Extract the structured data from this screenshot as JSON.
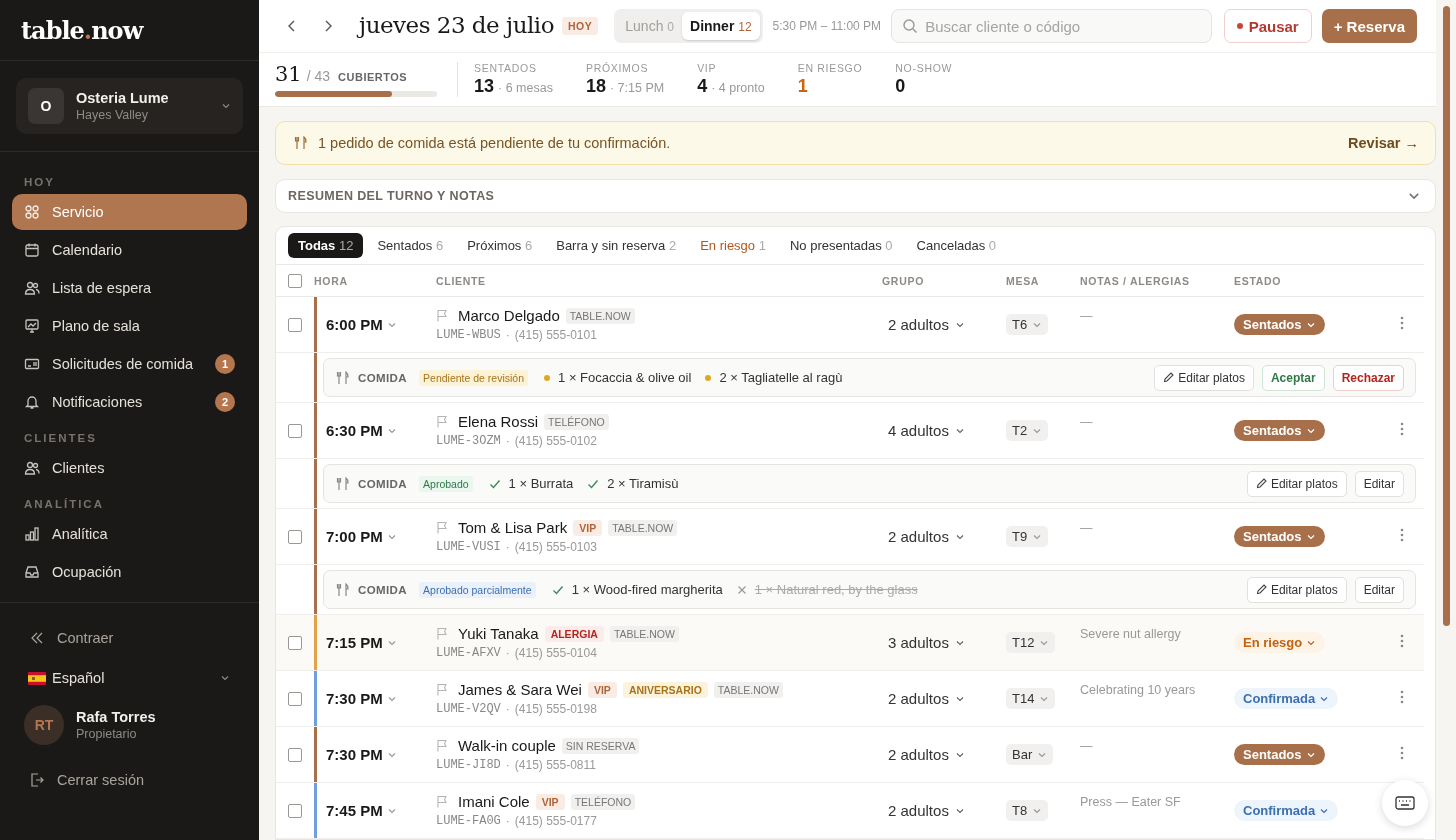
{
  "logo": {
    "before": "table",
    "dot": ".",
    "after": "now"
  },
  "venue": {
    "initial": "O",
    "name": "Osteria Lume",
    "area": "Hayes Valley"
  },
  "nav_sections": [
    {
      "title": "HOY",
      "items": [
        {
          "label": "Servicio",
          "kind": "grid",
          "selected": true
        },
        {
          "label": "Calendario",
          "kind": "calendar",
          "selected": false
        },
        {
          "label": "Lista de espera",
          "kind": "users",
          "selected": false
        },
        {
          "label": "Plano de sala",
          "kind": "board",
          "selected": false
        },
        {
          "label": "Solicitudes de comida",
          "kind": "ticket",
          "selected": false,
          "badge": "1"
        },
        {
          "label": "Notificaciones",
          "kind": "bell",
          "selected": false,
          "badge": "2"
        }
      ]
    },
    {
      "title": "CLIENTES",
      "items": [
        {
          "label": "Clientes",
          "kind": "users",
          "selected": false
        }
      ]
    },
    {
      "title": "ANALÍTICA",
      "items": [
        {
          "label": "Analítica",
          "kind": "chart",
          "selected": false
        },
        {
          "label": "Ocupación",
          "kind": "inbox",
          "selected": false
        }
      ]
    }
  ],
  "sidebar_footer": {
    "collapse": "Contraer",
    "language": "Español",
    "user": {
      "initials": "RT",
      "name": "Rafa Torres",
      "role": "Propietario"
    },
    "logout": "Cerrar sesión"
  },
  "header": {
    "date": "jueves 23 de julio",
    "today": "HOY",
    "shifts": [
      {
        "label": "Lunch",
        "count": "0",
        "selected": false
      },
      {
        "label": "Dinner",
        "count": "12",
        "selected": true
      }
    ],
    "hours": "5:30 PM – 11:00 PM",
    "search": {
      "placeholder": "Buscar cliente o código"
    },
    "pause": "Pausar",
    "new": "+ Reserva"
  },
  "stats": {
    "covers": {
      "value": "31",
      "total": "/ 43",
      "label": "CUBIERTOS",
      "level": 0.72
    },
    "metrics": [
      {
        "label": "SENTADOS",
        "value": "13",
        "detail": "· 6 mesas",
        "kind": "normal"
      },
      {
        "label": "PRÓXIMOS",
        "value": "18",
        "detail": "· 7:15 PM",
        "kind": "normal"
      },
      {
        "label": "VIP",
        "value": "4",
        "detail": "· 4 pronto",
        "kind": "normal"
      },
      {
        "label": "EN RIESGO",
        "value": "1",
        "kind": "warn"
      },
      {
        "label": "NO-SHOW",
        "value": "0",
        "kind": "normal"
      }
    ]
  },
  "alert": {
    "text": "1 pedido de comida está pendiente de tu confirmación.",
    "action": "Revisar →"
  },
  "summary": {
    "title": "RESUMEN DEL TURNO Y NOTAS"
  },
  "filters": [
    {
      "label": "Todas",
      "count": "12",
      "selected": true,
      "kind": "normal"
    },
    {
      "label": "Sentados",
      "count": "6",
      "selected": false,
      "kind": "normal"
    },
    {
      "label": "Próximos",
      "count": "6",
      "selected": false,
      "kind": "normal"
    },
    {
      "label": "Barra y sin reserva",
      "count": "2",
      "selected": false,
      "kind": "normal"
    },
    {
      "label": "En riesgo",
      "count": "1",
      "selected": false,
      "kind": "warn"
    },
    {
      "label": "No presentadas",
      "count": "0",
      "selected": false,
      "kind": "normal"
    },
    {
      "label": "Canceladas",
      "count": "0",
      "selected": false,
      "kind": "normal"
    }
  ],
  "table": {
    "select_all": {
      "checked": false
    },
    "columns": [
      "HORA",
      "CLIENTE",
      "GRUPO",
      "MESA",
      "NOTAS / ALERGIAS",
      "ESTADO"
    ],
    "rows": [
      {
        "checked": false,
        "time": "6:00 PM",
        "name": "Marco Delgado",
        "tags": [
          {
            "text": "TABLE.NOW",
            "kind": "source"
          }
        ],
        "code": "LUME-WBUS",
        "separator": "·",
        "phone": "(415) 555-0101",
        "party": "2 adultos",
        "table": "T6",
        "notes": "—",
        "status": {
          "label": "Sentados",
          "kind": "seated"
        },
        "food": {
          "label": "COMIDA",
          "status": {
            "text": "Pendiente de revisión",
            "kind": "pending"
          },
          "items": [
            {
              "text": "1 × Focaccia & olive oil",
              "kind": "pending"
            },
            {
              "text": "2 × Tagliatelle al ragù",
              "kind": "pending"
            }
          ],
          "actions": [
            {
              "label": "Editar platos",
              "kind": "edit"
            },
            {
              "label": "Aceptar",
              "kind": "accept"
            },
            {
              "label": "Rechazar",
              "kind": "reject"
            }
          ]
        }
      },
      {
        "checked": false,
        "time": "6:30 PM",
        "name": "Elena Rossi",
        "tags": [
          {
            "text": "TELÉFONO",
            "kind": "source"
          }
        ],
        "code": "LUME-3OZM",
        "separator": "·",
        "phone": "(415) 555-0102",
        "party": "4 adultos",
        "table": "T2",
        "notes": "—",
        "status": {
          "label": "Sentados",
          "kind": "seated"
        },
        "food": {
          "label": "COMIDA",
          "status": {
            "text": "Aprobado",
            "kind": "approved"
          },
          "items": [
            {
              "text": "1 × Burrata",
              "kind": "approved"
            },
            {
              "text": "2 × Tiramisù",
              "kind": "approved"
            }
          ],
          "actions": [
            {
              "label": "Editar platos",
              "kind": "edit"
            },
            {
              "label": "Editar",
              "kind": "plain"
            }
          ]
        }
      },
      {
        "checked": false,
        "time": "7:00 PM",
        "name": "Tom & Lisa Park",
        "tags": [
          {
            "text": "VIP",
            "kind": "vip"
          },
          {
            "text": "TABLE.NOW",
            "kind": "source"
          }
        ],
        "code": "LUME-VUSI",
        "separator": "·",
        "phone": "(415) 555-0103",
        "party": "2 adultos",
        "table": "T9",
        "notes": "—",
        "status": {
          "label": "Sentados",
          "kind": "seated"
        },
        "food": {
          "label": "COMIDA",
          "status": {
            "text": "Aprobado parcialmente",
            "kind": "partial"
          },
          "items": [
            {
              "text": "1 × Wood-fired margherita",
              "kind": "approved"
            },
            {
              "text": "1 × Natural red, by the glass",
              "kind": "rejected"
            }
          ],
          "actions": [
            {
              "label": "Editar platos",
              "kind": "edit"
            },
            {
              "label": "Editar",
              "kind": "plain"
            }
          ]
        }
      },
      {
        "checked": false,
        "time": "7:15 PM",
        "name": "Yuki Tanaka",
        "tags": [
          {
            "text": "ALERGIA",
            "kind": "allergy"
          },
          {
            "text": "TABLE.NOW",
            "kind": "source"
          }
        ],
        "code": "LUME-AFXV",
        "separator": "·",
        "phone": "(415) 555-0104",
        "party": "3 adultos",
        "table": "T12",
        "notes": "Severe nut allergy",
        "status": {
          "label": "En riesgo",
          "kind": "risk"
        }
      },
      {
        "checked": false,
        "time": "7:30 PM",
        "name": "James & Sara Wei",
        "tags": [
          {
            "text": "VIP",
            "kind": "vip"
          },
          {
            "text": "ANIVERSARIO",
            "kind": "anniversary"
          },
          {
            "text": "TABLE.NOW",
            "kind": "source"
          }
        ],
        "code": "LUME-V2QV",
        "separator": "·",
        "phone": "(415) 555-0198",
        "party": "2 adultos",
        "table": "T14",
        "notes": "Celebrating 10 years",
        "status": {
          "label": "Confirmada",
          "kind": "confirmed"
        }
      },
      {
        "checked": false,
        "time": "7:30 PM",
        "name": "Walk-in couple",
        "tags": [
          {
            "text": "SIN RESERVA",
            "kind": "source"
          }
        ],
        "code": "LUME-JI8D",
        "separator": "·",
        "phone": "(415) 555-0811",
        "party": "2 adultos",
        "table": "Bar",
        "notes": "—",
        "status": {
          "label": "Sentados",
          "kind": "seated"
        }
      },
      {
        "checked": false,
        "time": "7:45 PM",
        "name": "Imani Cole",
        "tags": [
          {
            "text": "VIP",
            "kind": "vip"
          },
          {
            "text": "TELÉFONO",
            "kind": "source"
          }
        ],
        "code": "LUME-FA0G",
        "separator": "·",
        "phone": "(415) 555-0177",
        "party": "2 adultos",
        "table": "T8",
        "notes": "Press — Eater SF",
        "status": {
          "label": "Confirmada",
          "kind": "confirmed"
        }
      }
    ]
  }
}
